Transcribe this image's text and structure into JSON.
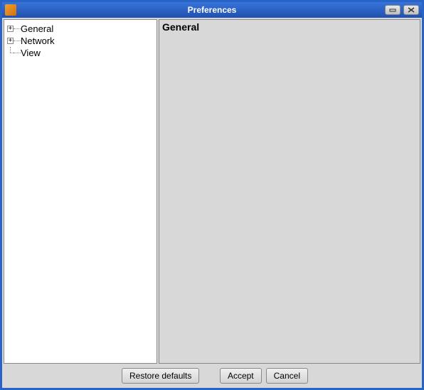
{
  "window": {
    "title": "Preferences"
  },
  "tree": {
    "items": [
      {
        "label": "General",
        "expandable": true
      },
      {
        "label": "Network",
        "expandable": true
      },
      {
        "label": "View",
        "expandable": false
      }
    ]
  },
  "detail": {
    "header": "General"
  },
  "buttons": {
    "restore": "Restore defaults",
    "accept": "Accept",
    "cancel": "Cancel"
  }
}
